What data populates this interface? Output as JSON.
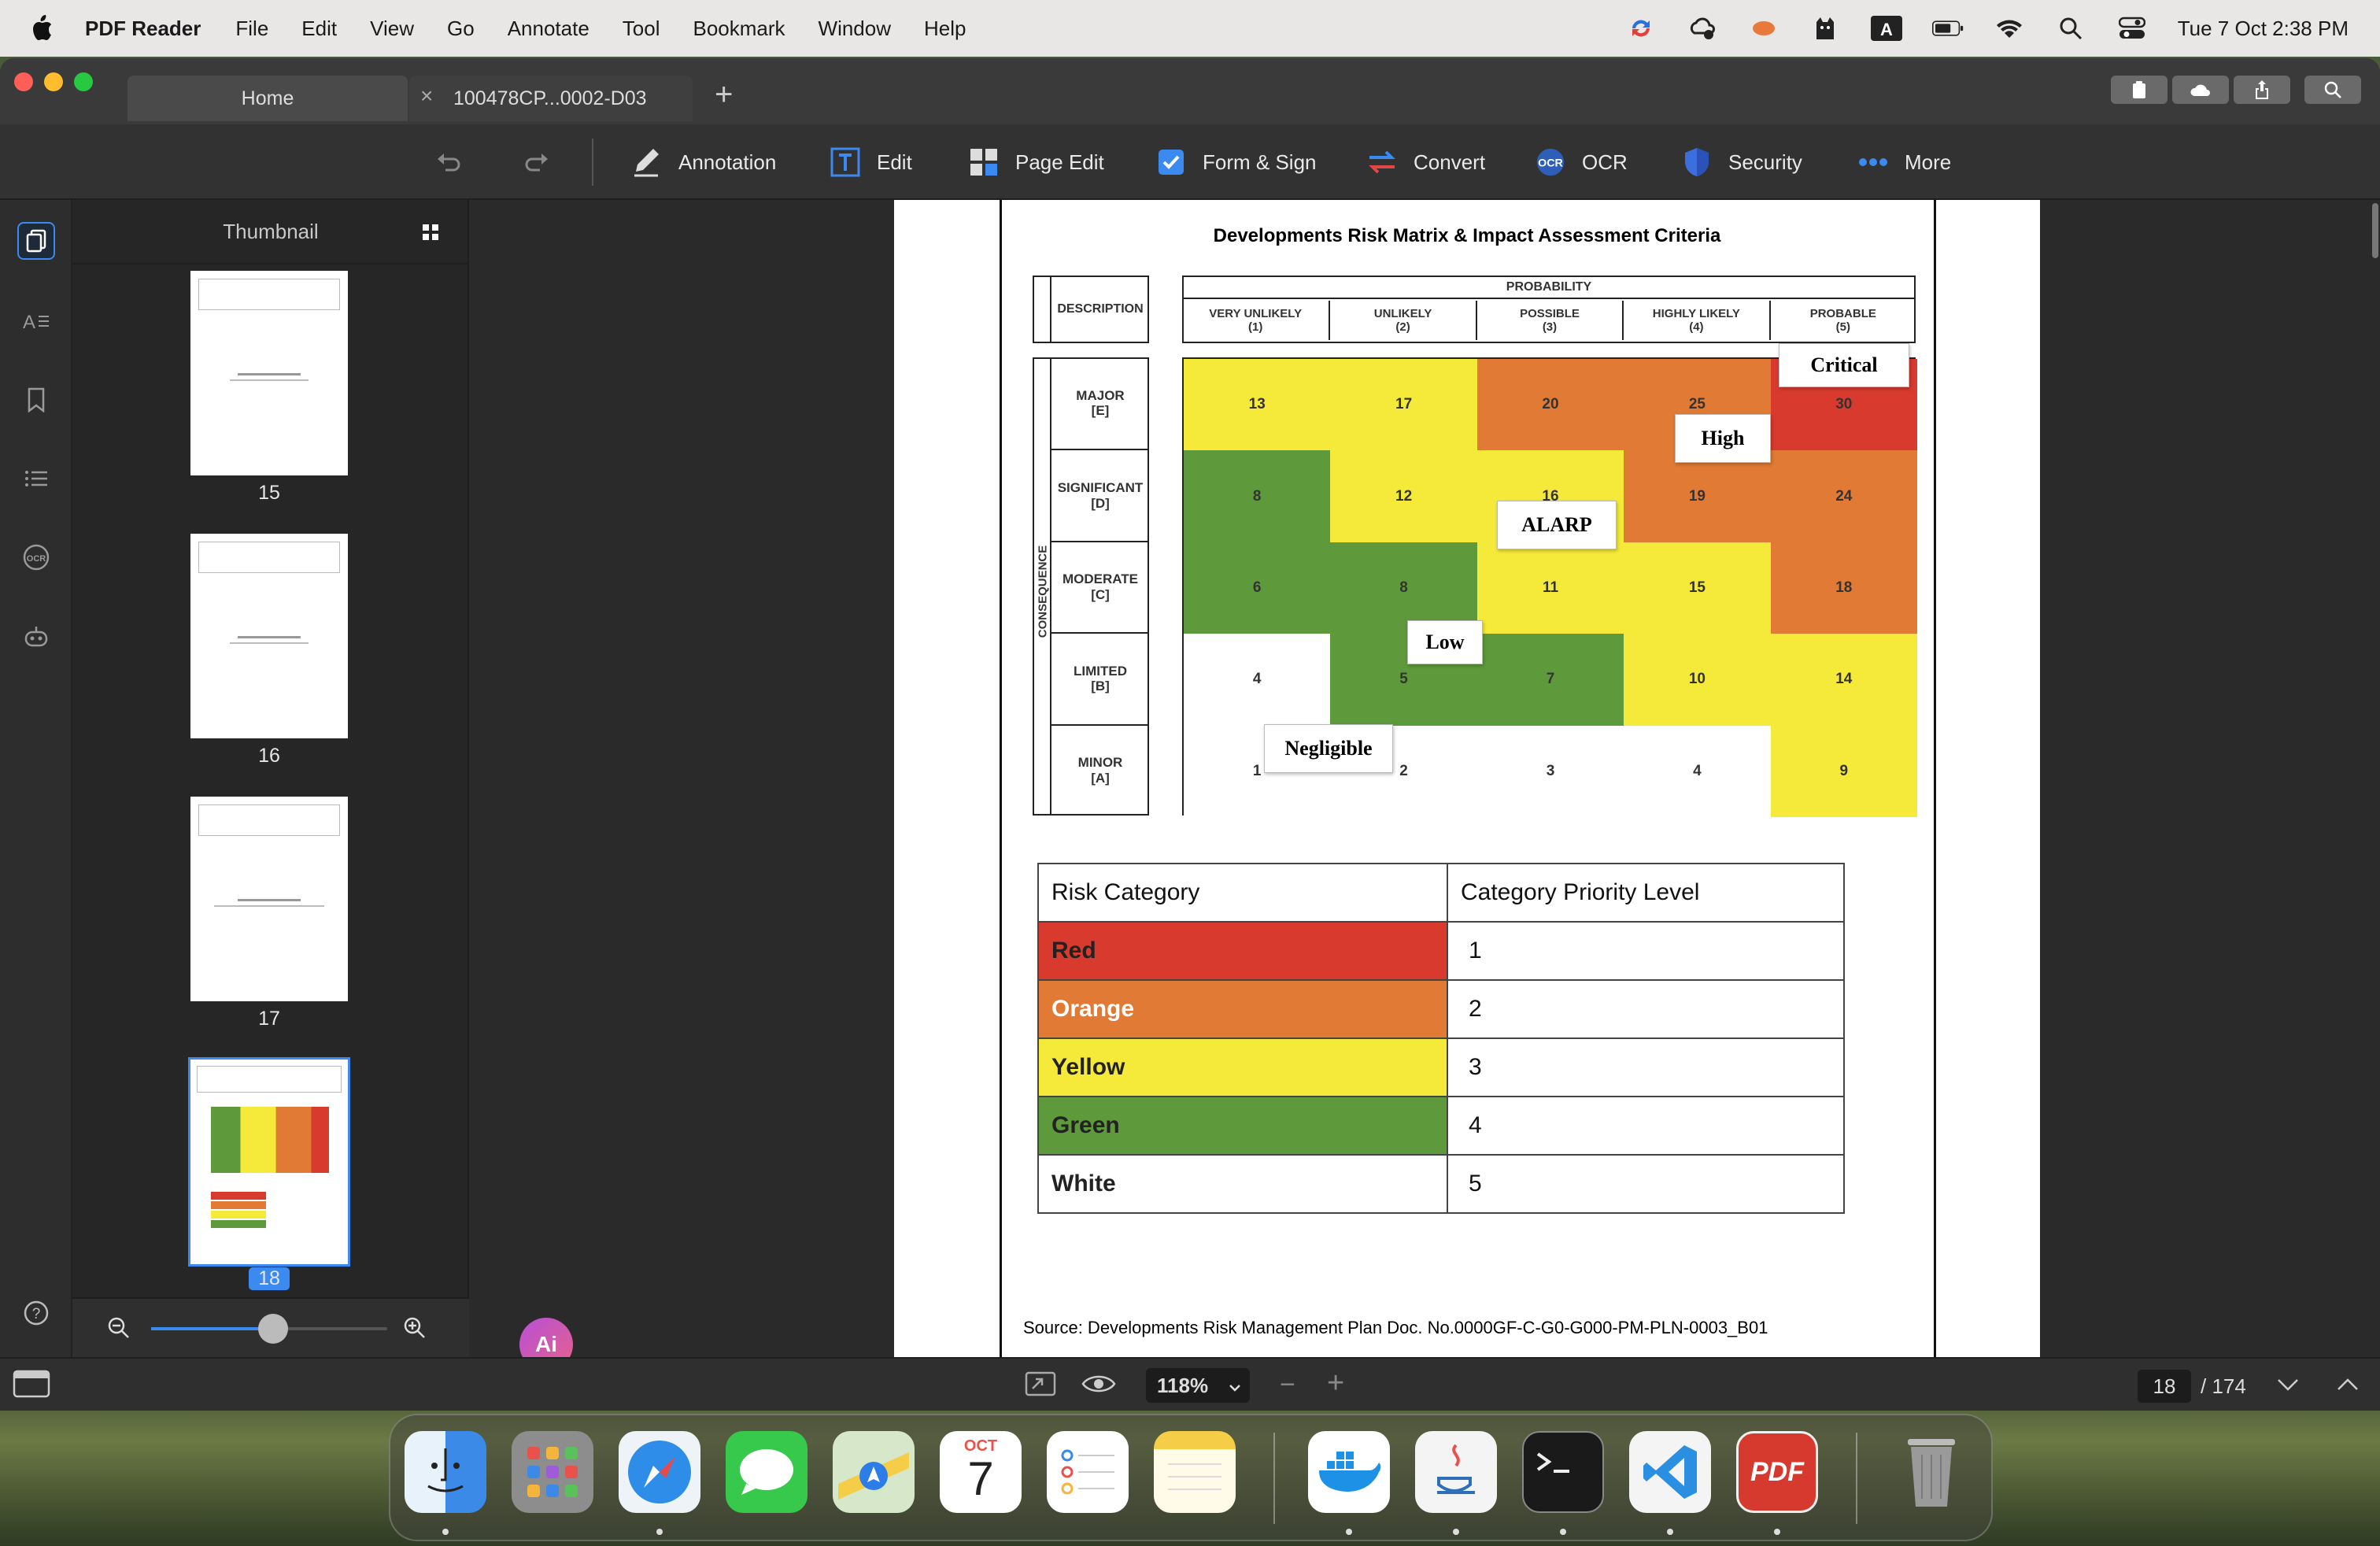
{
  "menubar": {
    "app": "PDF Reader",
    "items": [
      "File",
      "Edit",
      "View",
      "Go",
      "Annotate",
      "Tool",
      "Bookmark",
      "Window",
      "Help"
    ],
    "datetime": "Tue 7 Oct  2:38 PM"
  },
  "tabs": [
    {
      "label": "Home"
    },
    {
      "label": "100478CP...0002-D03"
    }
  ],
  "toolbar": {
    "annotation": "Annotation",
    "edit": "Edit",
    "page_edit": "Page Edit",
    "form_sign": "Form & Sign",
    "convert": "Convert",
    "ocr": "OCR",
    "security": "Security",
    "more": "More"
  },
  "thumbnails": {
    "header": "Thumbnail",
    "pages": [
      "15",
      "16",
      "17",
      "18"
    ],
    "selected": "18"
  },
  "document": {
    "title": "Developments Risk Matrix & Impact Assessment Criteria",
    "matrix": {
      "description_header": "DESCRIPTION",
      "probability_header": "PROBABILITY",
      "consequence_label": "CONSEQUENCE",
      "prob_cols": [
        {
          "name": "VERY UNLIKELY",
          "code": "(1)"
        },
        {
          "name": "UNLIKELY",
          "code": "(2)"
        },
        {
          "name": "POSSIBLE",
          "code": "(3)"
        },
        {
          "name": "HIGHLY LIKELY",
          "code": "(4)"
        },
        {
          "name": "PROBABLE",
          "code": "(5)"
        }
      ],
      "rows": [
        {
          "name": "MAJOR",
          "code": "[E]",
          "values": [
            "13",
            "17",
            "20",
            "25",
            "30"
          ],
          "colors": [
            "#f5ea3a",
            "#f5ea3a",
            "#e07a35",
            "#e07a35",
            "#d83a2e"
          ]
        },
        {
          "name": "SIGNIFICANT",
          "code": "[D]",
          "values": [
            "8",
            "12",
            "16",
            "19",
            "24"
          ],
          "colors": [
            "#5e9a3c",
            "#f5ea3a",
            "#f5ea3a",
            "#e07a35",
            "#e07a35"
          ]
        },
        {
          "name": "MODERATE",
          "code": "[C]",
          "values": [
            "6",
            "8",
            "11",
            "15",
            "18"
          ],
          "colors": [
            "#5e9a3c",
            "#5e9a3c",
            "#f5ea3a",
            "#f5ea3a",
            "#e07a35"
          ]
        },
        {
          "name": "LIMITED",
          "code": "[B]",
          "values": [
            "4",
            "5",
            "7",
            "10",
            "14"
          ],
          "colors": [
            "#ffffff",
            "#5e9a3c",
            "#5e9a3c",
            "#f5ea3a",
            "#f5ea3a"
          ]
        },
        {
          "name": "MINOR",
          "code": "[A]",
          "values": [
            "1",
            "2",
            "3",
            "4",
            "9"
          ],
          "colors": [
            "#ffffff",
            "#ffffff",
            "#ffffff",
            "#ffffff",
            "#f5ea3a"
          ]
        }
      ],
      "labels": {
        "critical": "Critical",
        "high": "High",
        "alarp": "ALARP",
        "low": "Low",
        "negligible": "Negligible"
      }
    },
    "category_table": {
      "headers": [
        "Risk Category",
        "Category Priority Level"
      ],
      "rows": [
        {
          "category": "Red",
          "level": "1",
          "color": "#d83a2e",
          "text_color": "#222"
        },
        {
          "category": "Orange",
          "level": "2",
          "color": "#e07a35",
          "text_color": "#fff"
        },
        {
          "category": "Yellow",
          "level": "3",
          "color": "#f5ea3a",
          "text_color": "#222"
        },
        {
          "category": "Green",
          "level": "4",
          "color": "#5e9a3c",
          "text_color": "#222"
        },
        {
          "category": "White",
          "level": "5",
          "color": "#ffffff",
          "text_color": "#222"
        }
      ]
    },
    "source": "Source: Developments Risk Management Plan Doc. No.0000GF-C-G0-G000-PM-PLN-0003_B01"
  },
  "statusbar": {
    "zoom": "118%",
    "page_current": "18",
    "page_total": "/ 174"
  },
  "ai_button": "Ai",
  "calendar": {
    "month": "OCT",
    "day": "7"
  },
  "pdf_dock_label": "PDF"
}
